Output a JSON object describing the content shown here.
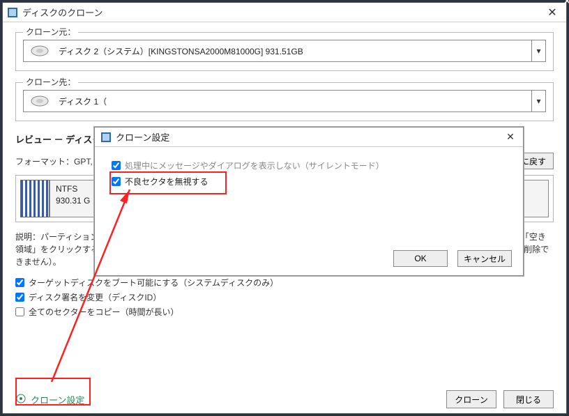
{
  "window": {
    "title": "ディスクのクローン"
  },
  "source": {
    "legend": "クローン元：",
    "text": "ディスク 2（システム）[KINGSTONSA2000M81000G]    931.51GB"
  },
  "dest": {
    "legend": "クローン先：",
    "text": "ディスク 1（"
  },
  "review": {
    "header": "レビュー － ディスク",
    "format_label": "フォーマット：GPT,",
    "reset": "期設定に戻す",
    "part_fs": "NTFS",
    "part_size": "930.31 G"
  },
  "description": "説明：パーティションの境界線をマウスで動かすことによって、各パーティションのサイズと開始/終了位置を調整することができます。「空き領域」をクリックすると、新しいボリュームを作成することができ、再度クリックすると、キャンセルできます（元のパーティションは削除できません）。",
  "options": {
    "bootable": "ターゲットディスクをブート可能にする（システムディスクのみ）",
    "disksig": "ディスク署名を変更（ディスクID）",
    "allsectors": "全てのセクターをコピー（時間が長い）"
  },
  "footer": {
    "link": "クローン設定",
    "clone": "クローン",
    "close": "閉じる"
  },
  "dialog": {
    "title": "クローン設定",
    "silent": "処理中にメッセージやダイアログを表示しない（サイレントモード）",
    "ignore_bad": "不良セクタを無視する",
    "ok": "OK",
    "cancel": "キャンセル"
  }
}
